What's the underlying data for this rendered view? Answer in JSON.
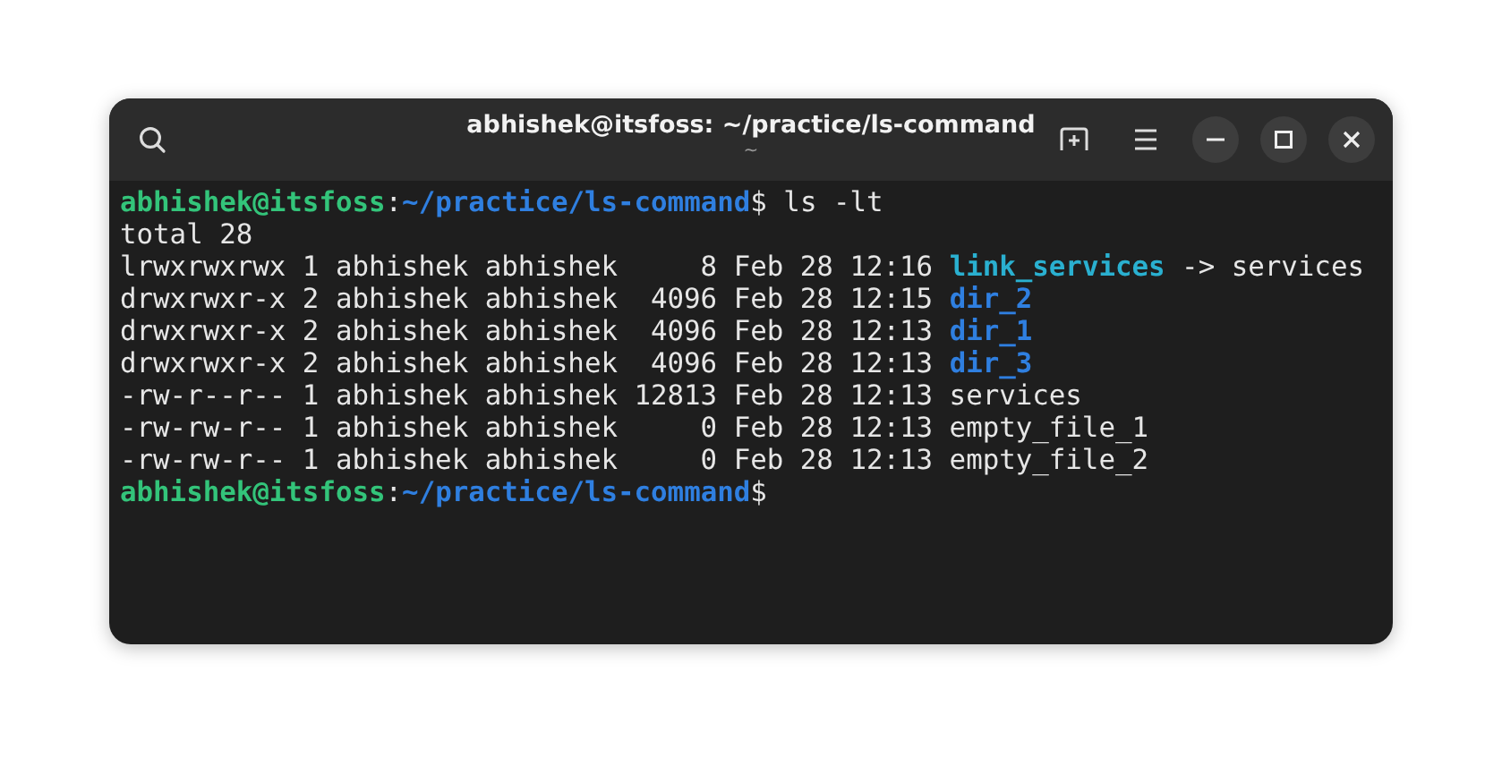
{
  "window": {
    "title": "abhishek@itsfoss: ~/practice/ls-command",
    "subtitle": "~"
  },
  "terminal": {
    "lines": [
      {
        "segments": [
          {
            "kind": "user",
            "text": "abhishek@itsfoss"
          },
          {
            "kind": "plain",
            "text": ":"
          },
          {
            "kind": "path",
            "text": "~/practice/ls-command"
          },
          {
            "kind": "plain",
            "text": "$ ls -lt"
          }
        ]
      },
      {
        "segments": [
          {
            "kind": "plain",
            "text": "total 28"
          }
        ]
      },
      {
        "segments": [
          {
            "kind": "plain",
            "text": "lrwxrwxrwx 1 abhishek abhishek     8 Feb 28 12:16 "
          },
          {
            "kind": "link",
            "text": "link_services"
          },
          {
            "kind": "plain",
            "text": " -> services"
          }
        ]
      },
      {
        "segments": [
          {
            "kind": "plain",
            "text": "drwxrwxr-x 2 abhishek abhishek  4096 Feb 28 12:15 "
          },
          {
            "kind": "dir",
            "text": "dir_2"
          }
        ]
      },
      {
        "segments": [
          {
            "kind": "plain",
            "text": "drwxrwxr-x 2 abhishek abhishek  4096 Feb 28 12:13 "
          },
          {
            "kind": "dir",
            "text": "dir_1"
          }
        ]
      },
      {
        "segments": [
          {
            "kind": "plain",
            "text": "drwxrwxr-x 2 abhishek abhishek  4096 Feb 28 12:13 "
          },
          {
            "kind": "dir",
            "text": "dir_3"
          }
        ]
      },
      {
        "segments": [
          {
            "kind": "plain",
            "text": "-rw-r--r-- 1 abhishek abhishek 12813 Feb 28 12:13 services"
          }
        ]
      },
      {
        "segments": [
          {
            "kind": "plain",
            "text": "-rw-rw-r-- 1 abhishek abhishek     0 Feb 28 12:13 empty_file_1"
          }
        ]
      },
      {
        "segments": [
          {
            "kind": "plain",
            "text": "-rw-rw-r-- 1 abhishek abhishek     0 Feb 28 12:13 empty_file_2"
          }
        ]
      },
      {
        "segments": [
          {
            "kind": "user",
            "text": "abhishek@itsfoss"
          },
          {
            "kind": "plain",
            "text": ":"
          },
          {
            "kind": "path",
            "text": "~/practice/ls-command"
          },
          {
            "kind": "plain",
            "text": "$"
          }
        ]
      }
    ]
  }
}
